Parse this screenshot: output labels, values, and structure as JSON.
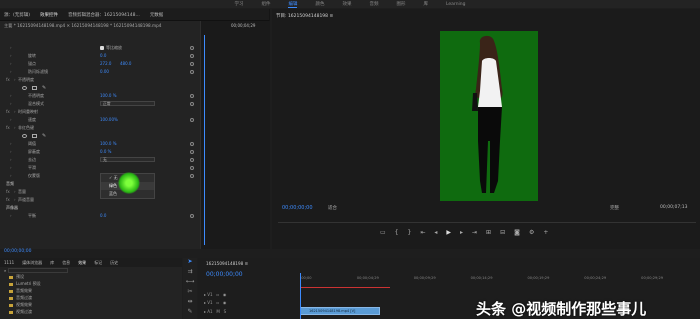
{
  "topbar": {
    "items": [
      "学习",
      "组件",
      "编辑",
      "颜色",
      "效果",
      "音频",
      "图形",
      "库",
      "Learning"
    ],
    "active_index": 2
  },
  "left_panel": {
    "tabs": [
      "源：(无剪辑)",
      "效果控件",
      "音频剪辑混合器：16215094148...",
      "元数据"
    ],
    "active_tab": 1,
    "clip_header": "主要 * 16215094148198.mp4 ✕ 16215094148198 * 16215094148198.mp4",
    "timeline_tc": "00;00;04;29",
    "rows": [
      {
        "label": "等比缩放",
        "value": "",
        "kind": "checkbox"
      },
      {
        "label": "旋转",
        "value": "0.0"
      },
      {
        "label": "锚点",
        "value": "272.0",
        "value2": "480.0"
      },
      {
        "label": "防闪烁滤镜",
        "value": "0.00"
      },
      {
        "label": "不透明度",
        "value": "",
        "kind": "section"
      },
      {
        "label": "",
        "value": "",
        "kind": "masks"
      },
      {
        "label": "不透明度",
        "value": "100.0 %"
      },
      {
        "label": "混合模式",
        "value": "正常",
        "kind": "dropdown"
      },
      {
        "label": "时间重映射",
        "value": "",
        "kind": "section"
      },
      {
        "label": "速度",
        "value": "100.00%"
      },
      {
        "label": "非红色键",
        "value": "",
        "kind": "section"
      },
      {
        "label": "",
        "value": "",
        "kind": "masks"
      },
      {
        "label": "阈值",
        "value": "100.0 %"
      },
      {
        "label": "屏蔽度",
        "value": "0.0 %"
      },
      {
        "label": "去边",
        "value": "无",
        "kind": "dropdown"
      },
      {
        "label": "平滑",
        "value": "",
        "kind": "plain"
      },
      {
        "label": "仅蒙版",
        "value": "",
        "kind": "plain"
      },
      {
        "label": "音频",
        "value": "",
        "kind": "header"
      },
      {
        "label": "音量",
        "value": "",
        "kind": "section"
      },
      {
        "label": "声道音量",
        "value": "",
        "kind": "section"
      },
      {
        "label": "声像器",
        "value": "",
        "kind": "header"
      },
      {
        "label": "平衡",
        "value": "0.0"
      }
    ],
    "dropdown_menu": {
      "options": [
        "无",
        "绿色",
        "蓝色"
      ],
      "selected": "无",
      "hovered": "绿色"
    },
    "footer_tc": "00;00;00;00"
  },
  "program": {
    "tab": "节目: 16215094148198 ≡",
    "timecode": "00;00;00;00",
    "fit": "适合",
    "quality": "完整",
    "end_tc": "00;00;07;13"
  },
  "project_panel": {
    "tabs": [
      "1111",
      "媒体浏览器",
      "库",
      "信息",
      "效果",
      "标记",
      "历史"
    ],
    "active_tab": 4,
    "search_placeholder": "",
    "items": [
      "预设",
      "Lumetri 预设",
      "音频效果",
      "音频过渡",
      "视频效果",
      "视频过渡"
    ]
  },
  "timeline": {
    "tab": "16215094148198 ≡",
    "timecode": "00;00;00;00",
    "ruler": [
      ";00;00",
      "00;00;04;29",
      "00;00;09;29",
      "00;00;14;29",
      "00;00;19;29",
      "00;00;24;29",
      "00;00;29;29"
    ],
    "clip_label": "16215094148198.mp4 [V]"
  },
  "watermark": "头条 @视频制作那些事儿"
}
